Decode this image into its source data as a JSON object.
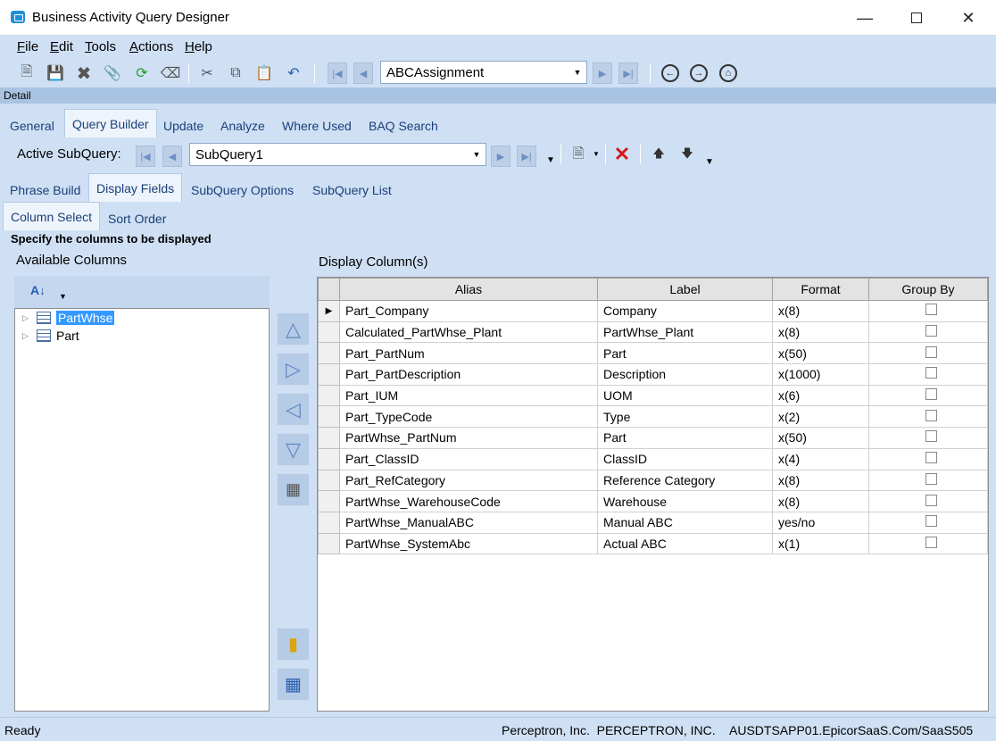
{
  "window": {
    "title": "Business Activity Query Designer"
  },
  "menu": {
    "file": "File",
    "edit": "Edit",
    "tools": "Tools",
    "actions": "Actions",
    "help": "Help"
  },
  "toolbar": {
    "query_id": "ABCAssignment"
  },
  "detail_label": "Detail",
  "main_tabs": [
    "General",
    "Query Builder",
    "Update",
    "Analyze",
    "Where Used",
    "BAQ Search"
  ],
  "subquery": {
    "label": "Active SubQuery:",
    "value": "SubQuery1"
  },
  "sub_tabs": [
    "Phrase Build",
    "Display Fields",
    "SubQuery Options",
    "SubQuery List"
  ],
  "inner_tabs": [
    "Column Select",
    "Sort Order"
  ],
  "instruction": "Specify the columns to be displayed",
  "available": {
    "title": "Available Columns",
    "items": [
      "PartWhse",
      "Part"
    ]
  },
  "display": {
    "title": "Display Column(s)",
    "headers": [
      "Alias",
      "Label",
      "Format",
      "Group By"
    ],
    "rows": [
      [
        "Part_Company",
        "Company",
        "x(8)"
      ],
      [
        "Calculated_PartWhse_Plant",
        "PartWhse_Plant",
        "x(8)"
      ],
      [
        "Part_PartNum",
        "Part",
        "x(50)"
      ],
      [
        "Part_PartDescription",
        "Description",
        "x(1000)"
      ],
      [
        "Part_IUM",
        "UOM",
        "x(6)"
      ],
      [
        "Part_TypeCode",
        "Type",
        "x(2)"
      ],
      [
        "PartWhse_PartNum",
        "Part",
        "x(50)"
      ],
      [
        "Part_ClassID",
        "ClassID",
        "x(4)"
      ],
      [
        "Part_RefCategory",
        "Reference Category",
        "x(8)"
      ],
      [
        "PartWhse_WarehouseCode",
        "Warehouse",
        "x(8)"
      ],
      [
        "PartWhse_ManualABC",
        "Manual ABC",
        "yes/no"
      ],
      [
        "PartWhse_SystemAbc",
        "Actual ABC",
        "x(1)"
      ]
    ]
  },
  "status": {
    "left": "Ready",
    "company": "Perceptron, Inc.  PERCEPTRON, INC.",
    "server": "AUSDTSAPP01.EpicorSaaS.Com/SaaS505"
  },
  "colors": {
    "accent": "#3399ff",
    "background": "#cfe0f4"
  }
}
